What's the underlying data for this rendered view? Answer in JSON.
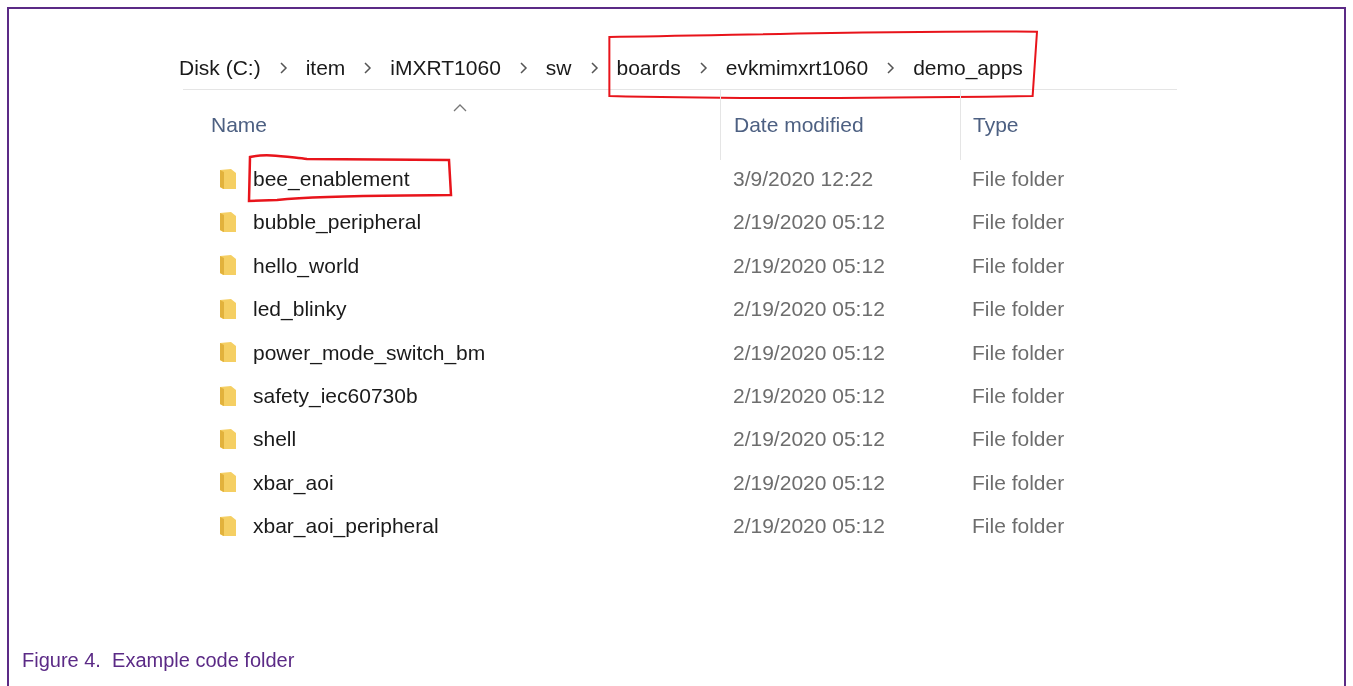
{
  "breadcrumb": [
    {
      "label": "Disk (C:)",
      "circled": false
    },
    {
      "label": "item",
      "circled": false
    },
    {
      "label": "iMXRT1060",
      "circled": false
    },
    {
      "label": "sw",
      "circled": false
    },
    {
      "label": "boards",
      "circled": true
    },
    {
      "label": "evkmimxrt1060",
      "circled": true
    },
    {
      "label": "demo_apps",
      "circled": true
    }
  ],
  "columns": [
    {
      "label": "Name",
      "sorted": true
    },
    {
      "label": "Date modified",
      "sorted": false
    },
    {
      "label": "Type",
      "sorted": false
    }
  ],
  "rows": [
    {
      "name": "bee_enablement",
      "date": "3/9/2020 12:22",
      "type": "File folder",
      "circled": true
    },
    {
      "name": "bubble_peripheral",
      "date": "2/19/2020 05:12",
      "type": "File folder",
      "circled": false
    },
    {
      "name": "hello_world",
      "date": "2/19/2020 05:12",
      "type": "File folder",
      "circled": false
    },
    {
      "name": "led_blinky",
      "date": "2/19/2020 05:12",
      "type": "File folder",
      "circled": false
    },
    {
      "name": "power_mode_switch_bm",
      "date": "2/19/2020 05:12",
      "type": "File folder",
      "circled": false
    },
    {
      "name": "safety_iec60730b",
      "date": "2/19/2020 05:12",
      "type": "File folder",
      "circled": false
    },
    {
      "name": "shell",
      "date": "2/19/2020 05:12",
      "type": "File folder",
      "circled": false
    },
    {
      "name": "xbar_aoi",
      "date": "2/19/2020 05:12",
      "type": "File folder",
      "circled": false
    },
    {
      "name": "xbar_aoi_peripheral",
      "date": "2/19/2020 05:12",
      "type": "File folder",
      "circled": false
    }
  ],
  "caption": "Figure 4.  Example code folder"
}
